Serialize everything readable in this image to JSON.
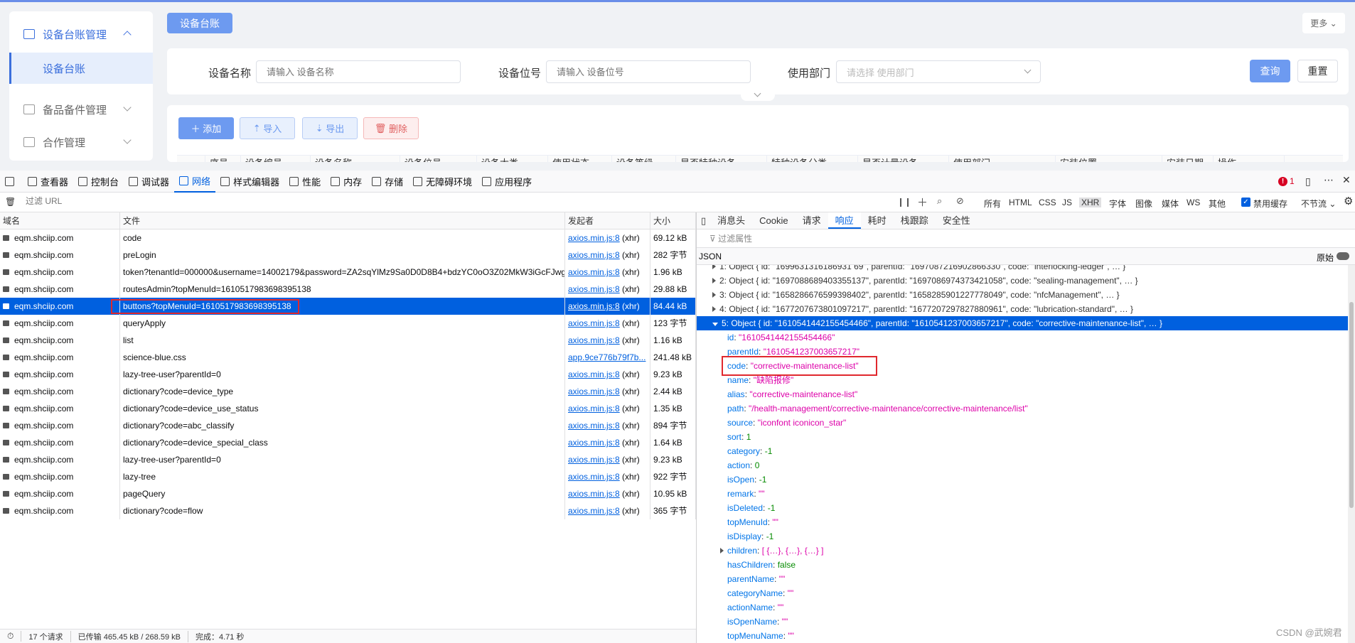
{
  "app": {
    "sidebar": {
      "parent_label": "设备台账管理",
      "active_label": "设备台账",
      "spare_label": "备品备件管理",
      "coop_label": "合作管理"
    },
    "tab_label": "设备台账",
    "more_label": "更多",
    "search": {
      "name_label": "设备名称",
      "name_placeholder": "请输入 设备名称",
      "position_label": "设备位号",
      "position_placeholder": "请输入 设备位号",
      "dept_label": "使用部门",
      "dept_placeholder": "请选择 使用部门",
      "query_label": "查询",
      "reset_label": "重置"
    },
    "toolbar": {
      "add_label": "添加",
      "import_label": "导入",
      "export_label": "导出",
      "delete_label": "删除"
    },
    "table_headers": [
      "",
      "序号",
      "设备编号",
      "设备名称",
      "设备位号",
      "设备大类",
      "使用状态",
      "设备等级",
      "是否特种设备",
      "特种设备分类",
      "是否计量设备",
      "使用部门",
      "安装位置",
      "安装日期",
      "操作"
    ]
  },
  "devtools": {
    "tabs": [
      "查看器",
      "控制台",
      "调试器",
      "网络",
      "样式编辑器",
      "性能",
      "内存",
      "存储",
      "无障碍环境",
      "应用程序"
    ],
    "active_tab": "网络",
    "error_count": "1",
    "filter_placeholder": "过滤 URL",
    "type_filters": [
      "所有",
      "HTML",
      "CSS",
      "JS",
      "XHR",
      "字体",
      "图像",
      "媒体",
      "WS",
      "其他"
    ],
    "disable_cache": "禁用缓存",
    "throttle": "不节流",
    "columns": [
      "域名",
      "文件",
      "发起者",
      "大小"
    ],
    "requests": [
      {
        "domain": "eqm.shciip.com",
        "file": "code",
        "initiator": "axios.min.js:8",
        "type": "(xhr)",
        "size": "69.12 kB"
      },
      {
        "domain": "eqm.shciip.com",
        "file": "preLogin",
        "initiator": "axios.min.js:8",
        "type": "(xhr)",
        "size": "282 字节"
      },
      {
        "domain": "eqm.shciip.com",
        "file": "token?tenantId=000000&username=14002179&password=ZA2sqYlMz9Sa0D0D8B4+bdzYC0oO3Z02MkW3iGcFJwg=&",
        "initiator": "axios.min.js:8",
        "type": "(xhr)",
        "size": "1.96 kB"
      },
      {
        "domain": "eqm.shciip.com",
        "file": "routesAdmin?topMenuId=1610517983698395138",
        "initiator": "axios.min.js:8",
        "type": "(xhr)",
        "size": "29.88 kB"
      },
      {
        "domain": "eqm.shciip.com",
        "file": "buttons?topMenuId=1610517983698395138",
        "initiator": "axios.min.js:8",
        "type": "(xhr)",
        "size": "84.44 kB"
      },
      {
        "domain": "eqm.shciip.com",
        "file": "queryApply",
        "initiator": "axios.min.js:8",
        "type": "(xhr)",
        "size": "123 字节"
      },
      {
        "domain": "eqm.shciip.com",
        "file": "list",
        "initiator": "axios.min.js:8",
        "type": "(xhr)",
        "size": "1.16 kB"
      },
      {
        "domain": "eqm.shciip.com",
        "file": "science-blue.css",
        "initiator": "app.9ce776b79f7b...",
        "type": "",
        "size": "241.48 kB"
      },
      {
        "domain": "eqm.shciip.com",
        "file": "lazy-tree-user?parentId=0",
        "initiator": "axios.min.js:8",
        "type": "(xhr)",
        "size": "9.23 kB"
      },
      {
        "domain": "eqm.shciip.com",
        "file": "dictionary?code=device_type",
        "initiator": "axios.min.js:8",
        "type": "(xhr)",
        "size": "2.44 kB"
      },
      {
        "domain": "eqm.shciip.com",
        "file": "dictionary?code=device_use_status",
        "initiator": "axios.min.js:8",
        "type": "(xhr)",
        "size": "1.35 kB"
      },
      {
        "domain": "eqm.shciip.com",
        "file": "dictionary?code=abc_classify",
        "initiator": "axios.min.js:8",
        "type": "(xhr)",
        "size": "894 字节"
      },
      {
        "domain": "eqm.shciip.com",
        "file": "dictionary?code=device_special_class",
        "initiator": "axios.min.js:8",
        "type": "(xhr)",
        "size": "1.64 kB"
      },
      {
        "domain": "eqm.shciip.com",
        "file": "lazy-tree-user?parentId=0",
        "initiator": "axios.min.js:8",
        "type": "(xhr)",
        "size": "9.23 kB"
      },
      {
        "domain": "eqm.shciip.com",
        "file": "lazy-tree",
        "initiator": "axios.min.js:8",
        "type": "(xhr)",
        "size": "922 字节"
      },
      {
        "domain": "eqm.shciip.com",
        "file": "pageQuery",
        "initiator": "axios.min.js:8",
        "type": "(xhr)",
        "size": "10.95 kB"
      },
      {
        "domain": "eqm.shciip.com",
        "file": "dictionary?code=flow",
        "initiator": "axios.min.js:8",
        "type": "(xhr)",
        "size": "365 字节"
      }
    ],
    "selected_request": 4,
    "status": {
      "requests": "17 个请求",
      "transferred": "已传输 465.45 kB / 268.59 kB",
      "finished": "完成：4.71 秒"
    },
    "response_tabs": [
      "消息头",
      "Cookie",
      "请求",
      "响应",
      "耗时",
      "栈跟踪",
      "安全性"
    ],
    "active_response_tab": "响应",
    "prop_filter": "过滤属性",
    "json_label": "JSON",
    "raw_label": "原始",
    "json_lines": [
      {
        "indent": 1,
        "arrow": true,
        "text": "1: Object { id: \"1699631316186931",
        "k": "",
        "v": "",
        "sel": false,
        "raw": "1: Object { id: \"1699631316186931 69\", parentId: \"1697087216902866330\", code: \"interlocking-ledger\", … }"
      },
      {
        "indent": 1,
        "arrow": true,
        "text": "2: Object { id: \"1697088689403355137\", parentId: \"1697086974373421058\", code: \"sealing-management\", … }",
        "sel": false
      },
      {
        "indent": 1,
        "arrow": true,
        "text": "3: Object { id: \"1658286676599398402\", parentId: \"1658285901227778049\", code: \"nfcManagement\", … }",
        "sel": false
      },
      {
        "indent": 1,
        "arrow": true,
        "text": "4: Object { id: \"1677207673801097217\", parentId: \"1677207297827880961\", code: \"lubrication-standard\", … }",
        "sel": false
      },
      {
        "indent": 1,
        "arrow": true,
        "text": "5: Object { id: \"1610541442155454466\", parentId: \"1610541237003657217\", code: \"corrective-maintenance-list\", … }",
        "sel": true
      },
      {
        "indent": 2,
        "k": "id",
        "v": "\"1610541442155454466\"",
        "t": "s"
      },
      {
        "indent": 2,
        "k": "parentId",
        "v": "\"1610541237003657217\"",
        "t": "s"
      },
      {
        "indent": 2,
        "k": "code",
        "v": "\"corrective-maintenance-list\"",
        "t": "s"
      },
      {
        "indent": 2,
        "k": "name",
        "v": "\"缺陷报修\"",
        "t": "s"
      },
      {
        "indent": 2,
        "k": "alias",
        "v": "\"corrective-maintenance-list\"",
        "t": "s"
      },
      {
        "indent": 2,
        "k": "path",
        "v": "\"/health-management/corrective-maintenance/corrective-maintenance/list\"",
        "t": "s"
      },
      {
        "indent": 2,
        "k": "source",
        "v": "\"iconfont iconicon_star\"",
        "t": "s"
      },
      {
        "indent": 2,
        "k": "sort",
        "v": "1",
        "t": "n"
      },
      {
        "indent": 2,
        "k": "category",
        "v": "-1",
        "t": "n"
      },
      {
        "indent": 2,
        "k": "action",
        "v": "0",
        "t": "n"
      },
      {
        "indent": 2,
        "k": "isOpen",
        "v": "-1",
        "t": "n"
      },
      {
        "indent": 2,
        "k": "remark",
        "v": "\"\"",
        "t": "s"
      },
      {
        "indent": 2,
        "k": "isDeleted",
        "v": "-1",
        "t": "n"
      },
      {
        "indent": 2,
        "k": "topMenuId",
        "v": "\"\"",
        "t": "s"
      },
      {
        "indent": 2,
        "k": "isDisplay",
        "v": "-1",
        "t": "n"
      },
      {
        "indent": 2,
        "arrow": true,
        "k": "children",
        "v": "[ {…}, {…}, {…} ]",
        "t": "s"
      },
      {
        "indent": 2,
        "k": "hasChildren",
        "v": "false",
        "t": "n"
      },
      {
        "indent": 2,
        "k": "parentName",
        "v": "\"\"",
        "t": "s"
      },
      {
        "indent": 2,
        "k": "categoryName",
        "v": "\"\"",
        "t": "s"
      },
      {
        "indent": 2,
        "k": "actionName",
        "v": "\"\"",
        "t": "s"
      },
      {
        "indent": 2,
        "k": "isOpenName",
        "v": "\"\"",
        "t": "s"
      },
      {
        "indent": 2,
        "k": "topMenuName",
        "v": "\"\"",
        "t": "s"
      }
    ],
    "watermark": "CSDN @武婉君"
  }
}
